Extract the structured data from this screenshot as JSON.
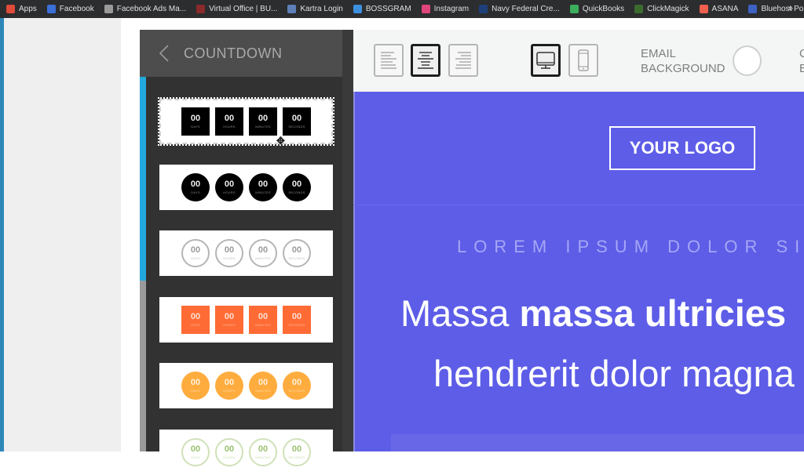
{
  "bookmarks": [
    {
      "label": "Apps",
      "icon": "apps-grid-icon",
      "color": "#e04b3a"
    },
    {
      "label": "Facebook",
      "icon": "facebook-icon",
      "color": "#3b6fd8"
    },
    {
      "label": "Facebook Ads Ma...",
      "icon": "page-icon",
      "color": "#9a9a9a"
    },
    {
      "label": "Virtual Office | BU...",
      "icon": "virtual-office-icon",
      "color": "#8a2a2a"
    },
    {
      "label": "Kartra Login",
      "icon": "kartra-icon",
      "color": "#5e7fb8"
    },
    {
      "label": "BOSSGRAM",
      "icon": "bossgram-icon",
      "color": "#3d8fe0"
    },
    {
      "label": "Instagram",
      "icon": "instagram-icon",
      "color": "#e0457a"
    },
    {
      "label": "Navy Federal Cre...",
      "icon": "navy-federal-icon",
      "color": "#1e3f7a"
    },
    {
      "label": "QuickBooks",
      "icon": "quickbooks-icon",
      "color": "#3cae5c"
    },
    {
      "label": "ClickMagick",
      "icon": "clickmagick-icon",
      "color": "#3b6b2e"
    },
    {
      "label": "ASANA",
      "icon": "asana-icon",
      "color": "#f0604f"
    },
    {
      "label": "Bluehost Portal",
      "icon": "bluehost-icon",
      "color": "#3d62c4"
    }
  ],
  "bookmarks_more": "»",
  "panel": {
    "title": "COUNTDOWN",
    "back_icon": "chevron-left-icon",
    "templates": [
      {
        "style": "sq-black",
        "selected": true
      },
      {
        "style": "ci-black",
        "selected": false
      },
      {
        "style": "ci-outline",
        "selected": false
      },
      {
        "style": "sq-orange",
        "selected": false
      },
      {
        "style": "ci-yellow",
        "selected": false
      },
      {
        "style": "ci-green",
        "selected": false
      }
    ],
    "units": [
      {
        "value": "00",
        "label": "DAYS"
      },
      {
        "value": "00",
        "label": "HOURS"
      },
      {
        "value": "00",
        "label": "MINUTES"
      },
      {
        "value": "00",
        "label": "SECONDS"
      }
    ]
  },
  "toolbar": {
    "align_buttons": [
      {
        "name": "align-left",
        "active": false
      },
      {
        "name": "align-center",
        "active": true
      },
      {
        "name": "align-right",
        "active": false
      }
    ],
    "device_buttons": [
      {
        "name": "desktop",
        "active": true
      },
      {
        "name": "mobile",
        "active": false
      }
    ],
    "email_background_label_line1": "EMAIL",
    "email_background_label_line2": "BACKGROUND",
    "email_background_color": "#ffffff",
    "cut_label_line1": "C",
    "cut_label_line2": "B"
  },
  "email": {
    "background_color": "#5d5de8",
    "logo_text": "YOUR LOGO",
    "kicker": "LOREM IPSUM DOLOR SIT",
    "headline_line1_regular": "Massa ",
    "headline_line1_bold": "massa ultricies",
    "headline_line2": "hendrerit dolor magna"
  }
}
